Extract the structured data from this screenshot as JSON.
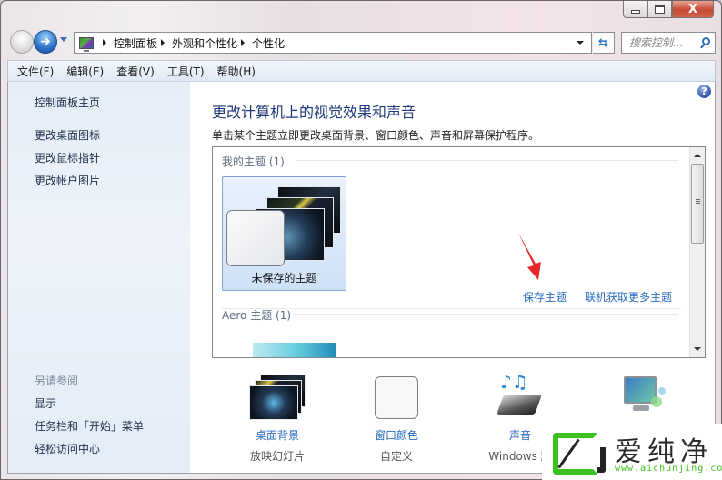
{
  "window": {
    "caption": {
      "minimize": "minimize",
      "maximize": "maximize",
      "close": "X"
    }
  },
  "nav": {
    "breadcrumb": [
      "控制面板",
      "外观和个性化",
      "个性化"
    ],
    "search_placeholder": "搜索控制...",
    "refresh_glyph": "⇆"
  },
  "menubar": {
    "items": [
      "文件(F)",
      "编辑(E)",
      "查看(V)",
      "工具(T)",
      "帮助(H)"
    ]
  },
  "sidebar": {
    "home": "控制面板主页",
    "links": [
      "更改桌面图标",
      "更改鼠标指针",
      "更改帐户图片"
    ],
    "see_also_heading": "另请参阅",
    "see_also": [
      "显示",
      "任务栏和「开始」菜单",
      "轻松访问中心"
    ]
  },
  "main": {
    "help_glyph": "?",
    "title": "更改计算机上的视觉效果和声音",
    "description": "单击某个主题立即更改桌面背景、窗口颜色、声音和屏幕保护程序。",
    "themes": {
      "my_themes_heading": "我的主题 (1)",
      "unsaved_theme_label": "未保存的主题",
      "save_theme_link": "保存主题",
      "get_more_link": "联机获取更多主题",
      "aero_heading": "Aero 主题 (1)"
    },
    "bottom_items": [
      {
        "title": "桌面背景",
        "subtitle": "放映幻灯片"
      },
      {
        "title": "窗口颜色",
        "subtitle": "自定义"
      },
      {
        "title": "声音",
        "subtitle": "Windows 默"
      },
      {
        "title": "",
        "subtitle": ""
      }
    ]
  },
  "watermark": {
    "text": "爱纯净",
    "url": "www.aichunjing.com"
  },
  "colors": {
    "link_blue": "#2a6bbd",
    "title_blue": "#1f3a7a",
    "annotation_red": "#e8262a",
    "watermark_green": "#3cc11e"
  }
}
